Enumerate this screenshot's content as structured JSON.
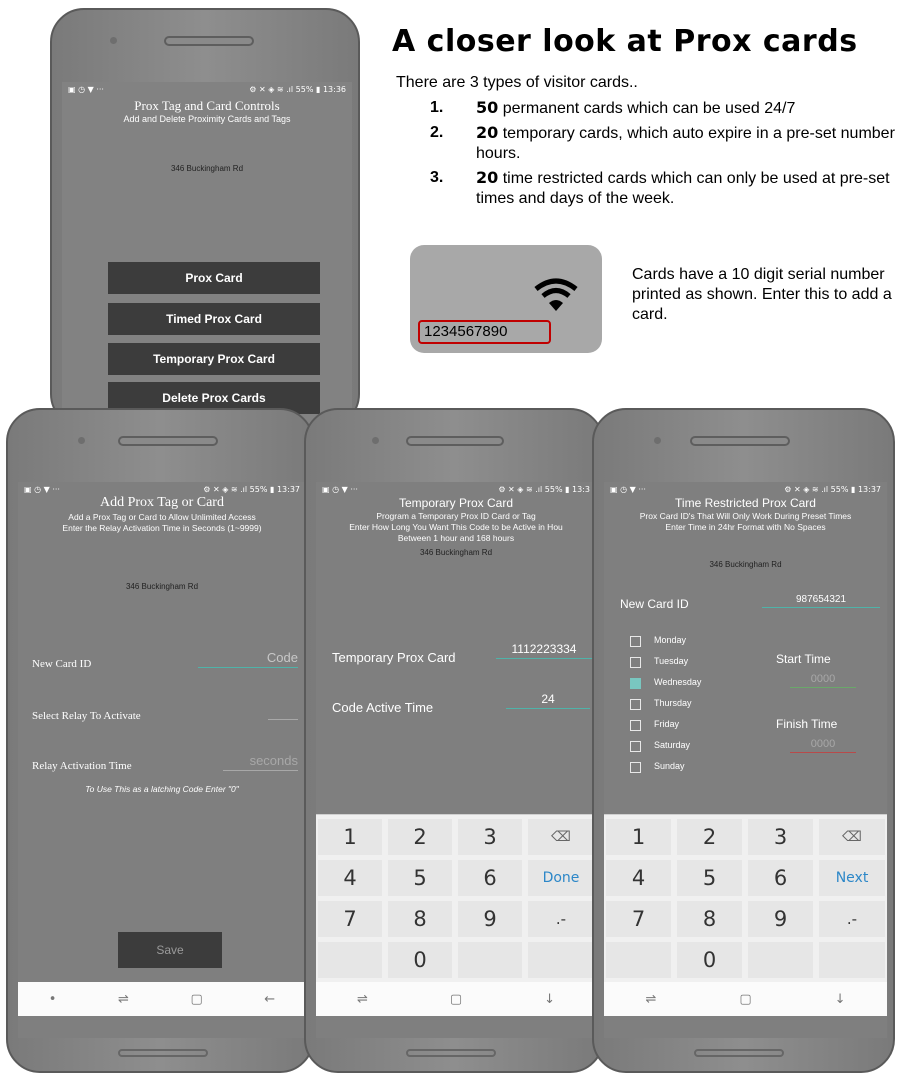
{
  "info": {
    "heading": "A closer look at Prox cards",
    "intro": "There are 3 types of visitor cards..",
    "items": [
      {
        "num": "1.",
        "count": "50",
        "text": " permanent cards which can be used 24/7"
      },
      {
        "num": "2.",
        "count": "20",
        "text": " temporary cards, which auto expire in a pre-set number of hours."
      },
      {
        "num": "3.",
        "count": "20",
        "text": " time restricted cards which can only be used at pre-set times and days of the week."
      }
    ],
    "card_serial": "1234567890",
    "card_note": "Cards have a 10 digit serial number printed as shown. Enter this to add a card."
  },
  "phone1": {
    "status_left": "▣ ◷ ▼ ···",
    "status_right": "⚙ ✕ ◈ ≋ .ıl 55% ▮ 13:36",
    "title": "Prox Tag and Card Controls",
    "subtitle": "Add and Delete Proximity Cards and Tags",
    "address": "346 Buckingham Rd",
    "buttons": [
      "Prox Card",
      "Timed Prox Card",
      "Temporary Prox Card",
      "Delete Prox Cards"
    ]
  },
  "phone2": {
    "status_left": "▣ ◷ ▼ ···",
    "status_right": "⚙ ✕ ◈ ≋ .ıl 55% ▮ 13:37",
    "title": "Add Prox Tag or Card",
    "line1": "Add a Prox Tag or Card to Allow Unlimited Access",
    "line2": "Enter the Relay Activation Time in Seconds (1~9999)",
    "address": "346 Buckingham Rd",
    "new_card_label": "New Card ID",
    "new_card_placeholder": "Code",
    "relay_label": "Select Relay To Activate",
    "time_label": "Relay Activation Time",
    "time_placeholder": "seconds",
    "note": "To Use This as a latching Code Enter \"0\"",
    "save": "Save",
    "nav": [
      "•",
      "⇌",
      "▢",
      "←"
    ]
  },
  "phone3": {
    "status_left": "▣ ◷ ▼ ···",
    "status_right": "⚙ ✕ ◈ ≋ .ıl 55% ▮ 13:3",
    "title": "Temporary Prox Card",
    "line1": "Program a Temporary Prox ID Card or Tag",
    "line2": "Enter How Long You Want This Code to be Active in Hou",
    "line3": "Between 1 hour and 168 hours",
    "address": "346 Buckingham Rd",
    "card_label": "Temporary Prox Card",
    "card_value": "1112223334",
    "time_label": "Code Active Time",
    "time_value": "24",
    "keys": [
      "1",
      "2",
      "3",
      "⌫",
      "4",
      "5",
      "6",
      "Done",
      "7",
      "8",
      "9",
      ".-",
      "",
      "0",
      "",
      ""
    ],
    "nav": [
      "⇌",
      "▢",
      "↓"
    ]
  },
  "phone4": {
    "status_left": "▣ ◷ ▼ ···",
    "status_right": "⚙ ✕ ◈ ≋ .ıl 55% ▮ 13:37",
    "title": "Time Restricted Prox Card",
    "line1": "Prox Card ID's That Will Only Work During Preset Times",
    "line2": "Enter Time in 24hr Format with No Spaces",
    "address": "346 Buckingham Rd",
    "card_label": "New Card ID",
    "card_value": "987654321",
    "days": [
      {
        "label": "Monday",
        "checked": false
      },
      {
        "label": "Tuesday",
        "checked": false
      },
      {
        "label": "Wednesday",
        "checked": true
      },
      {
        "label": "Thursday",
        "checked": false
      },
      {
        "label": "Friday",
        "checked": false
      },
      {
        "label": "Saturday",
        "checked": false
      },
      {
        "label": "Sunday",
        "checked": false
      }
    ],
    "start_label": "Start Time",
    "start_placeholder": "0000",
    "finish_label": "Finish Time",
    "finish_placeholder": "0000",
    "keys": [
      "1",
      "2",
      "3",
      "⌫",
      "4",
      "5",
      "6",
      "Next",
      "7",
      "8",
      "9",
      ".-",
      "",
      "0",
      "",
      ""
    ],
    "nav": [
      "⇌",
      "▢",
      "↓"
    ]
  },
  "colors": {
    "accent": "#4fb3a9",
    "key_action": "#2c87c8",
    "highlight_red": "#c00000",
    "button_dark": "#3c3c3c"
  }
}
